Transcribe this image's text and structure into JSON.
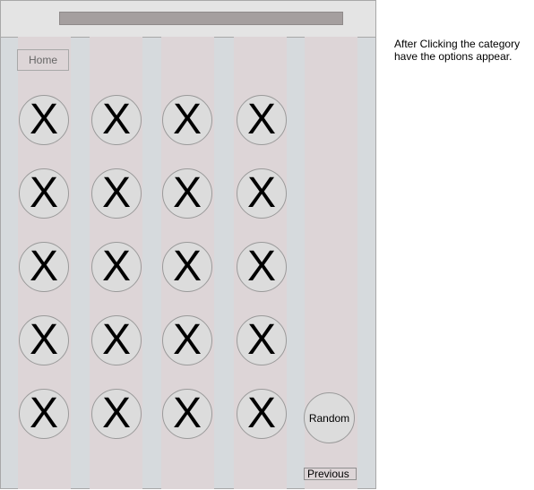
{
  "nav": {
    "home_label": "Home"
  },
  "grid": {
    "item_label": "X",
    "rows": [
      [
        "X",
        "X",
        "X",
        "X"
      ],
      [
        "X",
        "X",
        "X",
        "X"
      ],
      [
        "X",
        "X",
        "X",
        "X"
      ],
      [
        "X",
        "X",
        "X",
        "X"
      ],
      [
        "X",
        "X",
        "X",
        "X"
      ]
    ]
  },
  "side": {
    "random_label": "Random",
    "previous_label": "Previous"
  },
  "annotation": {
    "text": "After Clicking the category have the options appear."
  },
  "colors": {
    "frame_bg": "#d6dadd",
    "column_bg": "#ddd5d7",
    "search_bar": "#a59f9f",
    "circle_fill": "#dcdcdc"
  }
}
